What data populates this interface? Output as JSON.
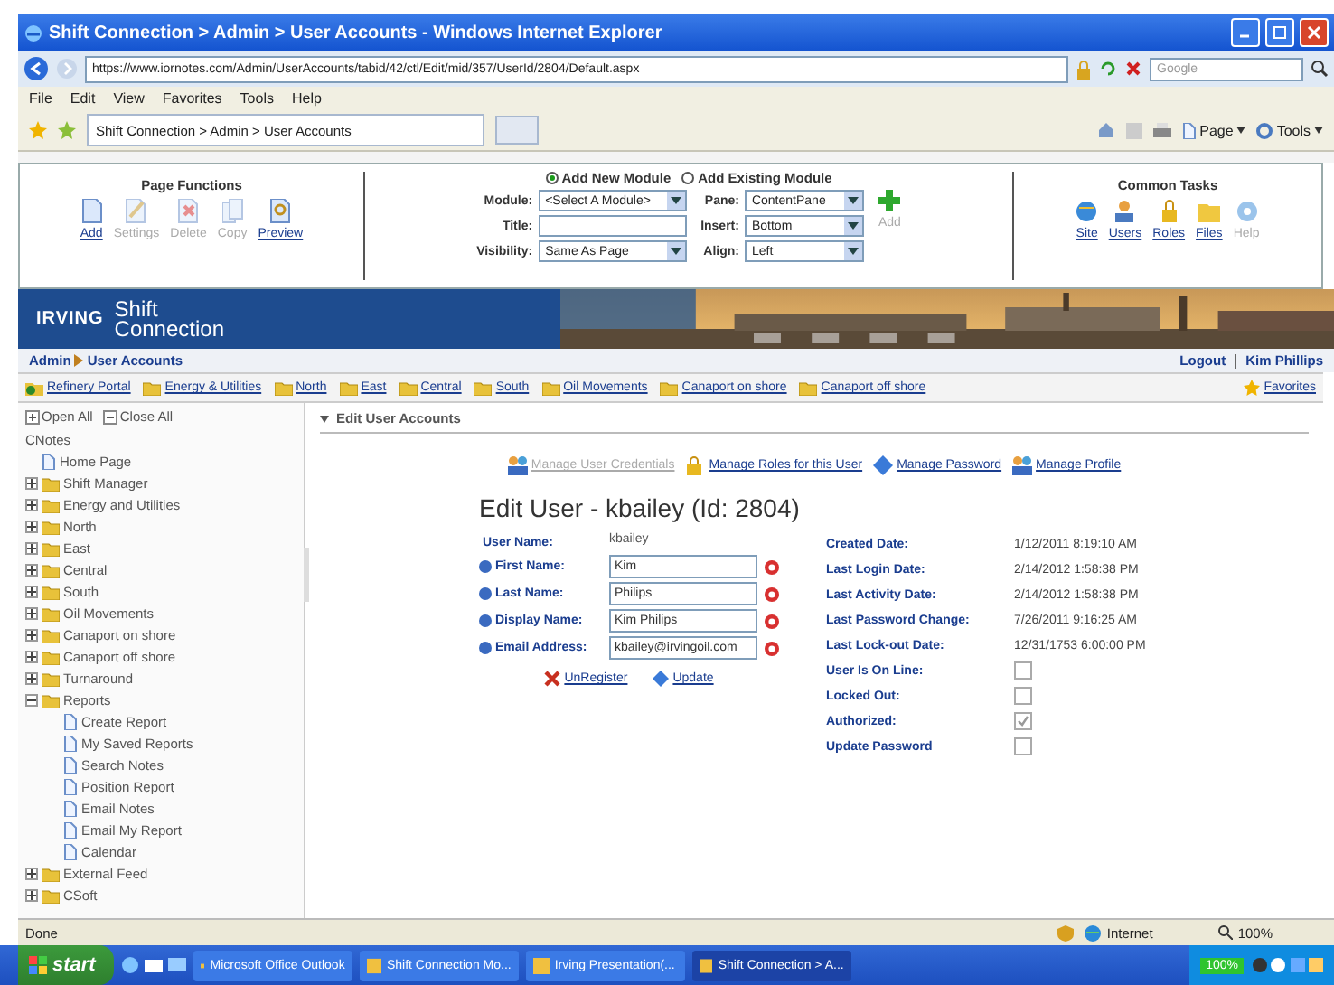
{
  "browser": {
    "title": "Shift Connection > Admin > User Accounts - Windows Internet Explorer",
    "address": "https://www.iornotes.com/Admin/UserAccounts/tabid/42/ctl/Edit/mid/357/UserId/2804/Default.aspx",
    "search_placeholder": "Google",
    "menu": [
      "File",
      "Edit",
      "View",
      "Favorites",
      "Tools",
      "Help"
    ],
    "tab": "Shift Connection > Admin > User Accounts",
    "tools": [
      "Page",
      "Tools"
    ]
  },
  "control_panel": {
    "page_functions": {
      "title": "Page Functions",
      "items": [
        {
          "label": "Add",
          "disabled": false
        },
        {
          "label": "Settings",
          "disabled": true
        },
        {
          "label": "Delete",
          "disabled": true
        },
        {
          "label": "Copy",
          "disabled": true
        },
        {
          "label": "Preview",
          "disabled": false
        }
      ]
    },
    "module": {
      "options": [
        {
          "label": "Add New Module",
          "selected": true
        },
        {
          "label": "Add Existing Module",
          "selected": false
        }
      ],
      "fields_left": [
        {
          "label": "Module:",
          "kind": "select",
          "value": "<Select A Module>"
        },
        {
          "label": "Title:",
          "kind": "text"
        },
        {
          "label": "Visibility:",
          "kind": "select",
          "value": "Same As Page"
        }
      ],
      "fields_right": [
        {
          "label": "Pane:",
          "kind": "select",
          "value": "ContentPane"
        },
        {
          "label": "Insert:",
          "kind": "select",
          "value": "Bottom"
        },
        {
          "label": "Align:",
          "kind": "select",
          "value": "Left"
        }
      ],
      "add_button": {
        "label": "Add",
        "disabled": true
      }
    },
    "common_tasks": {
      "title": "Common Tasks",
      "items": [
        {
          "label": "Site",
          "disabled": false
        },
        {
          "label": "Users",
          "disabled": false
        },
        {
          "label": "Roles",
          "disabled": false
        },
        {
          "label": "Files",
          "disabled": false
        },
        {
          "label": "Help",
          "disabled": true
        }
      ]
    }
  },
  "banner": {
    "logo": "IRVING",
    "brand_line_1": "Shift",
    "brand_line_2": "Connection"
  },
  "breadcrumb": [
    "Admin",
    "User Accounts"
  ],
  "user_links": [
    "Logout",
    "Kim Phillips"
  ],
  "links_bar": {
    "items": [
      "Refinery Portal",
      "Energy & Utilities",
      "North",
      "East",
      "Central",
      "South",
      "Oil Movements",
      "Canaport on shore",
      "Canaport off shore"
    ],
    "favorites": "Favorites"
  },
  "tree": {
    "open_all": "Open All",
    "close_all": "Close All",
    "root": "CNotes",
    "children": [
      {
        "label": "Home Page",
        "kind": "page"
      },
      {
        "label": "Shift Manager",
        "kind": "folder",
        "expanded": false
      },
      {
        "label": "Energy and Utilities",
        "kind": "folder",
        "expanded": false
      },
      {
        "label": "North",
        "kind": "folder",
        "expanded": false
      },
      {
        "label": "East",
        "kind": "folder",
        "expanded": false
      },
      {
        "label": "Central",
        "kind": "folder",
        "expanded": false
      },
      {
        "label": "South",
        "kind": "folder",
        "expanded": false
      },
      {
        "label": "Oil Movements",
        "kind": "folder",
        "expanded": false
      },
      {
        "label": "Canaport on shore",
        "kind": "folder",
        "expanded": false
      },
      {
        "label": "Canaport off shore",
        "kind": "folder",
        "expanded": false
      },
      {
        "label": "Turnaround",
        "kind": "folder",
        "expanded": false
      },
      {
        "label": "Reports",
        "kind": "folder",
        "expanded": true,
        "children": [
          {
            "label": "Create Report",
            "kind": "page"
          },
          {
            "label": "My Saved Reports",
            "kind": "page"
          },
          {
            "label": "Search Notes",
            "kind": "page"
          },
          {
            "label": "Position Report",
            "kind": "page"
          },
          {
            "label": "Email Notes",
            "kind": "page"
          },
          {
            "label": "Email My Report",
            "kind": "page"
          },
          {
            "label": "Calendar",
            "kind": "page"
          }
        ]
      },
      {
        "label": "External Feed",
        "kind": "folder",
        "expanded": false
      },
      {
        "label": "CSoft",
        "kind": "folder",
        "expanded": false
      }
    ]
  },
  "section_title": "Edit User Accounts",
  "actions": [
    {
      "label": "Manage User Credentials",
      "disabled": true
    },
    {
      "label": "Manage Roles for this User",
      "disabled": false
    },
    {
      "label": "Manage Password",
      "disabled": false
    },
    {
      "label": "Manage Profile",
      "disabled": false
    }
  ],
  "heading": "Edit User - kbailey (Id: 2804)",
  "user_fields": [
    {
      "label": "User Name:",
      "kind": "readonly",
      "value": "kbailey"
    },
    {
      "label": "First Name:",
      "kind": "input",
      "value": "Kim"
    },
    {
      "label": "Last Name:",
      "kind": "input",
      "value": "Philips"
    },
    {
      "label": "Display Name:",
      "kind": "input",
      "value": "Kim Philips"
    },
    {
      "label": "Email Address:",
      "kind": "input",
      "value": "kbailey@irvingoil.com"
    }
  ],
  "form_buttons": [
    "UnRegister",
    "Update"
  ],
  "details": [
    {
      "label": "Created Date:",
      "kind": "text",
      "value": "1/12/2011 8:19:10 AM"
    },
    {
      "label": "Last Login Date:",
      "kind": "text",
      "value": "2/14/2012 1:58:38 PM"
    },
    {
      "label": "Last Activity Date:",
      "kind": "text",
      "value": "2/14/2012 1:58:38 PM"
    },
    {
      "label": "Last Password Change:",
      "kind": "text",
      "value": "7/26/2011 9:16:25 AM"
    },
    {
      "label": "Last Lock-out Date:",
      "kind": "text",
      "value": "12/31/1753 6:00:00 PM"
    },
    {
      "label": "User Is On Line:",
      "kind": "checkbox",
      "checked": false
    },
    {
      "label": "Locked Out:",
      "kind": "checkbox",
      "checked": false
    },
    {
      "label": "Authorized:",
      "kind": "checkbox",
      "checked": true
    },
    {
      "label": "Update Password",
      "kind": "checkbox",
      "checked": false
    }
  ],
  "status_bar": {
    "text": "Done",
    "zone": "Internet",
    "zoom": "100%"
  },
  "taskbar": {
    "start": "start",
    "windows": [
      {
        "label": "Microsoft Office Outlook",
        "selected": false
      },
      {
        "label": "Shift Connection Mo...",
        "selected": false
      },
      {
        "label": "Irving Presentation(...",
        "selected": false
      },
      {
        "label": "Shift Connection > A...",
        "selected": true
      }
    ],
    "battery": "100%"
  }
}
